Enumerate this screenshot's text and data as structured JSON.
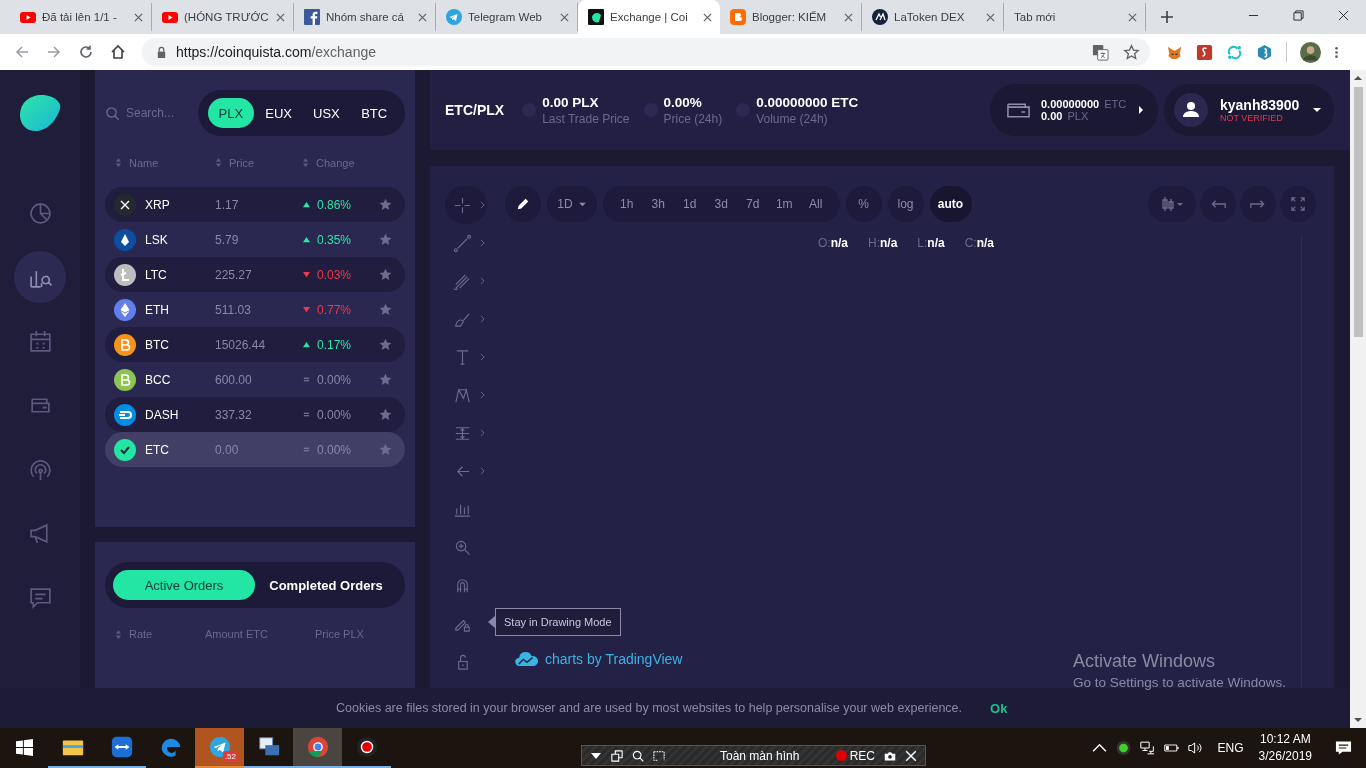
{
  "browser": {
    "tabs": [
      {
        "title": "Đã tải lên 1/1 -",
        "kind": "youtube",
        "selected": false
      },
      {
        "title": "(HÓNG TRƯỚC",
        "kind": "youtube",
        "selected": false
      },
      {
        "title": "Nhóm share cá",
        "kind": "facebook",
        "selected": false
      },
      {
        "title": "Telegram Web",
        "kind": "telegram",
        "selected": false
      },
      {
        "title": "Exchange | Coi",
        "kind": "app",
        "selected": true
      },
      {
        "title": "Blogger: KIẾM",
        "kind": "blogger",
        "selected": false
      },
      {
        "title": "LaToken DEX",
        "kind": "latoken",
        "selected": false
      },
      {
        "title": "Tab mới",
        "kind": "blank",
        "selected": false
      }
    ],
    "url_host": "https://coinquista.com",
    "url_path": "/exchange"
  },
  "nav": [
    {
      "kind": "dashboard",
      "selected": false
    },
    {
      "kind": "exchange",
      "selected": true
    },
    {
      "kind": "calendar",
      "selected": false
    },
    {
      "kind": "wallet",
      "selected": false
    },
    {
      "kind": "broadcast",
      "selected": false
    },
    {
      "kind": "megaphone",
      "selected": false
    },
    {
      "kind": "chat",
      "selected": false
    }
  ],
  "market": {
    "search": {
      "placeholder": "Search..."
    },
    "quotes": [
      {
        "label": "PLX",
        "selected": true
      },
      {
        "label": "EUX",
        "selected": false
      },
      {
        "label": "USX",
        "selected": false
      },
      {
        "label": "BTC",
        "selected": false
      }
    ],
    "columns": [
      "Name",
      "Price",
      "Change"
    ],
    "rows": [
      {
        "symbol": "XRP",
        "price": "1.17",
        "change": "0.86%",
        "kind": "up",
        "color": "#23292f",
        "selected": false
      },
      {
        "symbol": "LSK",
        "price": "5.79",
        "change": "0.35%",
        "kind": "up",
        "color": "#0d4ea0",
        "selected": false
      },
      {
        "symbol": "LTC",
        "price": "225.27",
        "change": "0.03%",
        "kind": "down",
        "color": "#bdbdbd",
        "selected": false
      },
      {
        "symbol": "ETH",
        "price": "511.03",
        "change": "0.77%",
        "kind": "down",
        "color": "#627eea",
        "selected": false
      },
      {
        "symbol": "BTC",
        "price": "15026.44",
        "change": "0.17%",
        "kind": "up",
        "color": "#f7931a",
        "selected": false
      },
      {
        "symbol": "BCC",
        "price": "600.00",
        "change": "0.00%",
        "kind": "flat",
        "color": "#8dc351",
        "selected": false
      },
      {
        "symbol": "DASH",
        "price": "337.32",
        "change": "0.00%",
        "kind": "flat",
        "color": "#008de4",
        "selected": false
      },
      {
        "symbol": "ETC",
        "price": "0.00",
        "change": "0.00%",
        "kind": "flat",
        "color": "#23e5a4",
        "selected": true
      }
    ]
  },
  "orders": {
    "tabs": [
      {
        "label": "Active Orders",
        "selected": true
      },
      {
        "label": "Completed Orders",
        "selected": false
      }
    ],
    "columns": [
      "Rate",
      "Amount ETC",
      "Price PLX"
    ]
  },
  "header": {
    "pair": "ETC/PLX",
    "stats": [
      {
        "value": "0.00 PLX",
        "label": "Last Trade Price"
      },
      {
        "value": "0.00%",
        "label": "Price (24h)"
      },
      {
        "value": "0.00000000 ETC",
        "label": "Volume (24h)"
      }
    ],
    "balances": [
      {
        "amount": "0.00000000",
        "unit": "ETC"
      },
      {
        "amount": "0.00",
        "unit": "PLX"
      }
    ],
    "user": {
      "name": "kyanh83900",
      "status": "NOT VERIFIED"
    }
  },
  "chart": {
    "interval": "1D",
    "periods": [
      "1h",
      "3h",
      "1d",
      "3d",
      "7d",
      "1m",
      "All"
    ],
    "scales": [
      {
        "label": "%",
        "selected": false
      },
      {
        "label": "log",
        "selected": false
      },
      {
        "label": "auto",
        "selected": true
      }
    ],
    "ohlc": [
      {
        "key": "O:",
        "value": "n/a"
      },
      {
        "key": "H:",
        "value": "n/a"
      },
      {
        "key": "L:",
        "value": "n/a"
      },
      {
        "key": "C:",
        "value": "n/a"
      }
    ],
    "tools": [
      {
        "kind": "crosshair",
        "selected": true,
        "submenu": true
      },
      {
        "kind": "line",
        "selected": false,
        "submenu": true
      },
      {
        "kind": "fork",
        "selected": false,
        "submenu": true
      },
      {
        "kind": "brush",
        "selected": false,
        "submenu": true
      },
      {
        "kind": "text",
        "selected": false,
        "submenu": true
      },
      {
        "kind": "nodes",
        "selected": false,
        "submenu": true
      },
      {
        "kind": "measure",
        "selected": false,
        "submenu": true
      },
      {
        "kind": "arrow",
        "selected": false,
        "submenu": true
      },
      {
        "kind": "ruler",
        "selected": false,
        "submenu": false
      },
      {
        "kind": "zoom",
        "selected": false,
        "submenu": false
      },
      {
        "kind": "magnet",
        "selected": false,
        "submenu": false
      },
      {
        "kind": "pencil-lock",
        "selected": false,
        "submenu": false,
        "tooltip": "Stay in Drawing Mode"
      },
      {
        "kind": "lock",
        "selected": false,
        "submenu": false
      }
    ],
    "attribution": "charts by TradingView"
  },
  "cookie": {
    "text": "Cookies are files stored in your browser and are used by most websites to help personalise your web experience.",
    "button": "Ok"
  },
  "activation": {
    "title": "Activate Windows",
    "subtitle": "Go to Settings to activate Windows."
  },
  "taskbar": {
    "apps": [
      {
        "kind": "explorer",
        "running": true,
        "active": false,
        "flashing": false
      },
      {
        "kind": "teamviewer",
        "running": true,
        "active": false,
        "flashing": false
      },
      {
        "kind": "edge",
        "running": false,
        "active": false,
        "flashing": false
      },
      {
        "kind": "telegram",
        "running": true,
        "active": false,
        "flashing": true,
        "badge": ".52"
      },
      {
        "kind": "remote",
        "running": true,
        "active": false,
        "flashing": false
      },
      {
        "kind": "chrome",
        "running": true,
        "active": true,
        "flashing": false
      },
      {
        "kind": "recorder",
        "running": true,
        "active": false,
        "flashing": false
      }
    ],
    "recorder": {
      "label": "Toàn màn hình",
      "rec": "REC"
    },
    "language": "ENG",
    "time": "10:12 AM",
    "date": "3/26/2019"
  }
}
